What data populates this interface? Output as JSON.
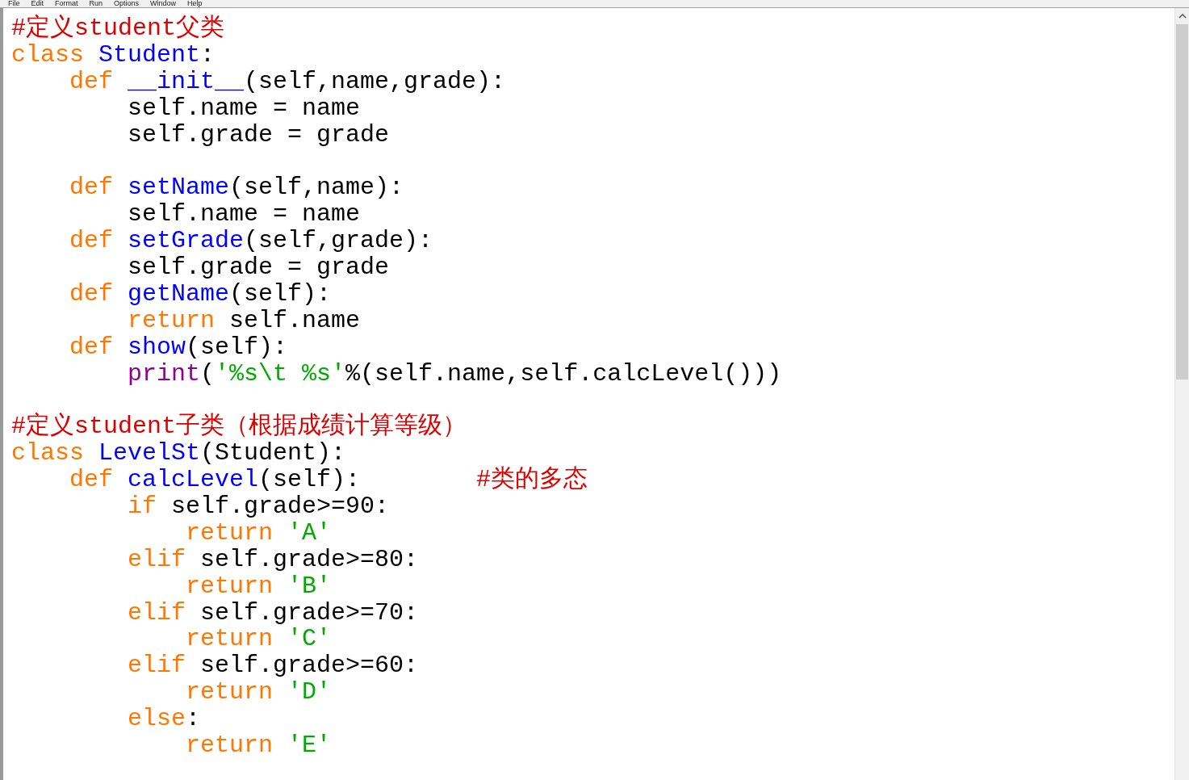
{
  "menu": [
    "File",
    "Edit",
    "Format",
    "Run",
    "Options",
    "Window",
    "Help"
  ],
  "lines": [
    {
      "kind": "code",
      "tokens": [
        {
          "kind": "comment",
          "text": "#定义student父类"
        }
      ]
    },
    {
      "kind": "code",
      "tokens": [
        {
          "kind": "keyword",
          "text": "class"
        },
        {
          "kind": "definition",
          "text": " Student"
        },
        {
          "kind": "plain",
          "text": ":"
        }
      ]
    },
    {
      "kind": "code",
      "tokens": [
        {
          "kind": "keyword",
          "text": "    def"
        },
        {
          "kind": "definition",
          "text": " __init__"
        },
        {
          "kind": "plain",
          "text": "(self,name,grade):"
        }
      ]
    },
    {
      "kind": "code",
      "tokens": [
        {
          "kind": "plain",
          "text": "        self.name = name"
        }
      ]
    },
    {
      "kind": "code",
      "tokens": [
        {
          "kind": "plain",
          "text": "        self.grade = grade"
        }
      ]
    },
    {
      "kind": "blank"
    },
    {
      "kind": "code",
      "tokens": [
        {
          "kind": "keyword",
          "text": "    def"
        },
        {
          "kind": "definition",
          "text": " setName"
        },
        {
          "kind": "plain",
          "text": "(self,name):"
        }
      ]
    },
    {
      "kind": "code",
      "tokens": [
        {
          "kind": "plain",
          "text": "        self.name = name"
        }
      ]
    },
    {
      "kind": "code",
      "tokens": [
        {
          "kind": "keyword",
          "text": "    def"
        },
        {
          "kind": "definition",
          "text": " setGrade"
        },
        {
          "kind": "plain",
          "text": "(self,grade):"
        }
      ]
    },
    {
      "kind": "code",
      "tokens": [
        {
          "kind": "plain",
          "text": "        self.grade = grade"
        }
      ]
    },
    {
      "kind": "code",
      "tokens": [
        {
          "kind": "keyword",
          "text": "    def"
        },
        {
          "kind": "definition",
          "text": " getName"
        },
        {
          "kind": "plain",
          "text": "(self):"
        }
      ]
    },
    {
      "kind": "code",
      "tokens": [
        {
          "kind": "keyword",
          "text": "        return"
        },
        {
          "kind": "plain",
          "text": " self.name"
        }
      ]
    },
    {
      "kind": "code",
      "tokens": [
        {
          "kind": "keyword",
          "text": "    def"
        },
        {
          "kind": "definition",
          "text": " show"
        },
        {
          "kind": "plain",
          "text": "(self):"
        }
      ]
    },
    {
      "kind": "code",
      "tokens": [
        {
          "kind": "builtin",
          "text": "        print"
        },
        {
          "kind": "plain",
          "text": "("
        },
        {
          "kind": "string",
          "text": "'%s\\t %s'"
        },
        {
          "kind": "plain",
          "text": "%(self.name,self.calcLevel()))"
        }
      ]
    },
    {
      "kind": "blank"
    },
    {
      "kind": "code",
      "tokens": [
        {
          "kind": "comment",
          "text": "#定义student子类（根据成绩计算等级）"
        }
      ]
    },
    {
      "kind": "code",
      "tokens": [
        {
          "kind": "keyword",
          "text": "class"
        },
        {
          "kind": "definition",
          "text": " LevelSt"
        },
        {
          "kind": "plain",
          "text": "(Student):"
        }
      ]
    },
    {
      "kind": "code",
      "tokens": [
        {
          "kind": "keyword",
          "text": "    def"
        },
        {
          "kind": "definition",
          "text": " calcLevel"
        },
        {
          "kind": "plain",
          "text": "(self):"
        },
        {
          "kind": "comment",
          "text": "        #类的多态"
        }
      ]
    },
    {
      "kind": "code",
      "tokens": [
        {
          "kind": "keyword",
          "text": "        if"
        },
        {
          "kind": "plain",
          "text": " self.grade>=90:"
        }
      ]
    },
    {
      "kind": "code",
      "tokens": [
        {
          "kind": "keyword",
          "text": "            return"
        },
        {
          "kind": "string",
          "text": " 'A'"
        }
      ]
    },
    {
      "kind": "code",
      "tokens": [
        {
          "kind": "keyword",
          "text": "        elif"
        },
        {
          "kind": "plain",
          "text": " self.grade>=80:"
        }
      ]
    },
    {
      "kind": "code",
      "tokens": [
        {
          "kind": "keyword",
          "text": "            return"
        },
        {
          "kind": "string",
          "text": " 'B'"
        }
      ]
    },
    {
      "kind": "code",
      "tokens": [
        {
          "kind": "keyword",
          "text": "        elif"
        },
        {
          "kind": "plain",
          "text": " self.grade>=70:"
        }
      ]
    },
    {
      "kind": "code",
      "tokens": [
        {
          "kind": "keyword",
          "text": "            return"
        },
        {
          "kind": "string",
          "text": " 'C'"
        }
      ]
    },
    {
      "kind": "code",
      "tokens": [
        {
          "kind": "keyword",
          "text": "        elif"
        },
        {
          "kind": "plain",
          "text": " self.grade>=60:"
        }
      ]
    },
    {
      "kind": "code",
      "tokens": [
        {
          "kind": "keyword",
          "text": "            return"
        },
        {
          "kind": "string",
          "text": " 'D'"
        }
      ]
    },
    {
      "kind": "code",
      "tokens": [
        {
          "kind": "keyword",
          "text": "        else"
        },
        {
          "kind": "plain",
          "text": ":"
        }
      ]
    },
    {
      "kind": "code",
      "tokens": [
        {
          "kind": "keyword",
          "text": "            return"
        },
        {
          "kind": "string",
          "text": " 'E'"
        }
      ]
    }
  ]
}
